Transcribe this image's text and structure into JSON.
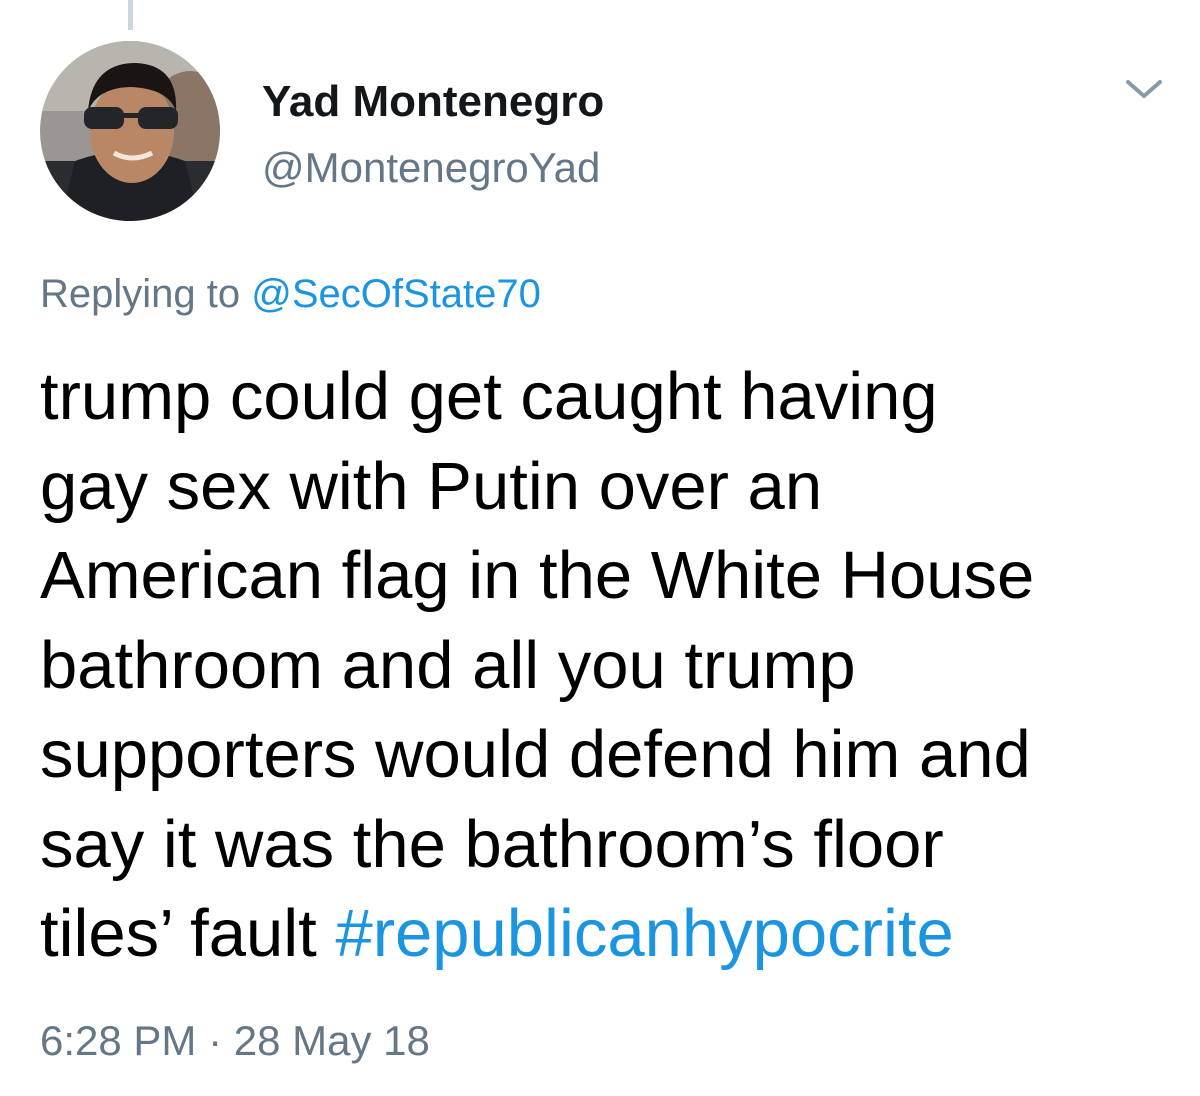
{
  "tweet": {
    "author": {
      "display_name": "Yad Montenegro",
      "handle": "@MontenegroYad",
      "avatar_icon": "user-avatar"
    },
    "menu_icon": "chevron-down-icon",
    "reply_context": {
      "prefix": "Replying to",
      "mention": "@SecOfState70"
    },
    "text_lines": [
      "trump could get caught having",
      "gay sex with Putin over an",
      "American flag in the White House",
      "bathroom and all you trump",
      "supporters would defend him and",
      "say it was the bathroom’s floor",
      "tiles’ fault"
    ],
    "hashtag": "#republicanhypocrite",
    "timestamp": "6:28 PM · 28 May 18"
  },
  "colors": {
    "link": "#1b95e0",
    "secondary_text": "#657786",
    "primary_text": "#14171a",
    "thread_line": "#ccd6dd"
  }
}
